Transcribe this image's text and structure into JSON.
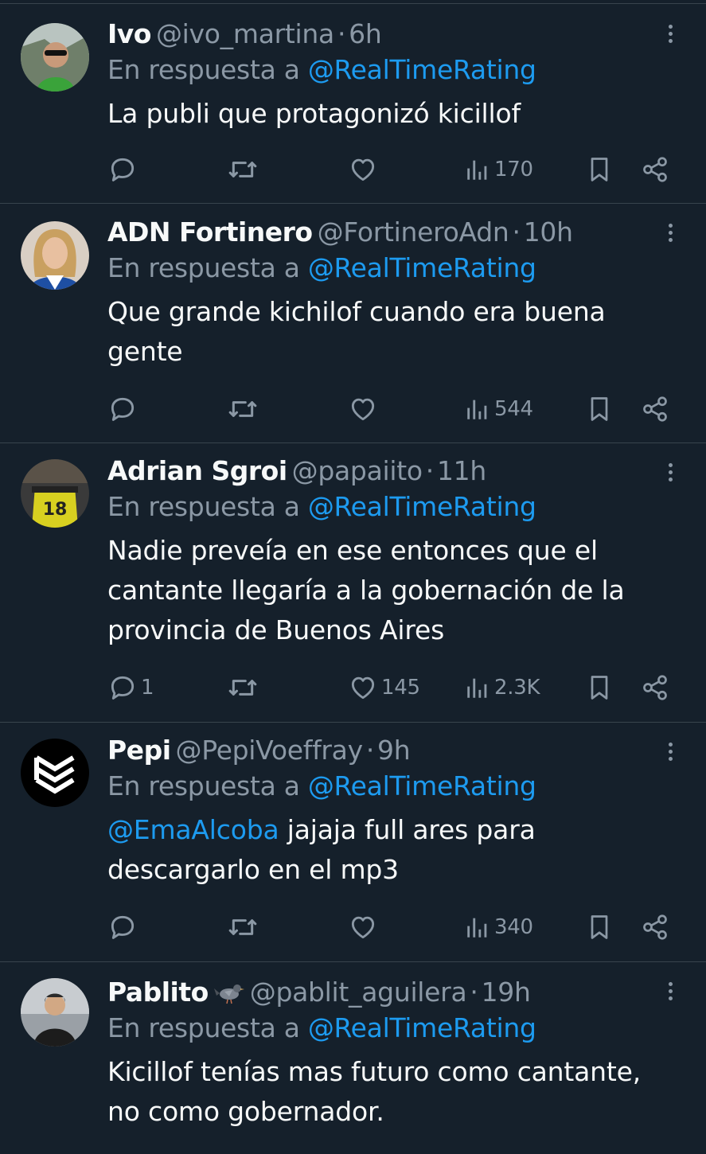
{
  "colors": {
    "background": "#15202b",
    "text": "#f7f9f9",
    "muted": "#8b98a5",
    "link": "#1d9bf0",
    "divider": "#38444d"
  },
  "reply_prefix": "En respuesta a",
  "tweets": [
    {
      "name": "Ivo",
      "handle": "@ivo_martina",
      "time": "6h",
      "reply_to": "@RealTimeRating",
      "mention": "",
      "text": "La publi que protagonizó kicillof",
      "replies": "",
      "retweets": "",
      "likes": "",
      "views": "170"
    },
    {
      "name": "ADN Fortinero",
      "handle": "@FortineroAdn",
      "time": "10h",
      "reply_to": "@RealTimeRating",
      "mention": "",
      "text": "Que grande kichilof cuando era buena gente",
      "replies": "",
      "retweets": "",
      "likes": "",
      "views": "544"
    },
    {
      "name": "Adrian Sgroi",
      "handle": "@papaiito",
      "time": "11h",
      "reply_to": "@RealTimeRating",
      "mention": "",
      "text": "Nadie preveía en ese entonces que el cantante llegaría a la gobernación de la provincia de Buenos Aires",
      "replies": "1",
      "retweets": "",
      "likes": "145",
      "views": "2.3K"
    },
    {
      "name": "Pepi",
      "handle": "@PepiVoeffray",
      "time": "9h",
      "reply_to": "@RealTimeRating",
      "mention": "@EmaAlcoba",
      "text": "jajaja full ares para descargarlo en el mp3",
      "replies": "",
      "retweets": "",
      "likes": "",
      "views": "340"
    },
    {
      "name": "Pablito",
      "name_emoji_icon": "pigeon-icon",
      "handle": "@pablit_aguilera",
      "time": "19h",
      "reply_to": "@RealTimeRating",
      "mention": "",
      "text": "Kicillof tenías mas futuro como cantante, no como gobernador.",
      "replies": "",
      "retweets": "",
      "likes": "",
      "views": ""
    }
  ]
}
